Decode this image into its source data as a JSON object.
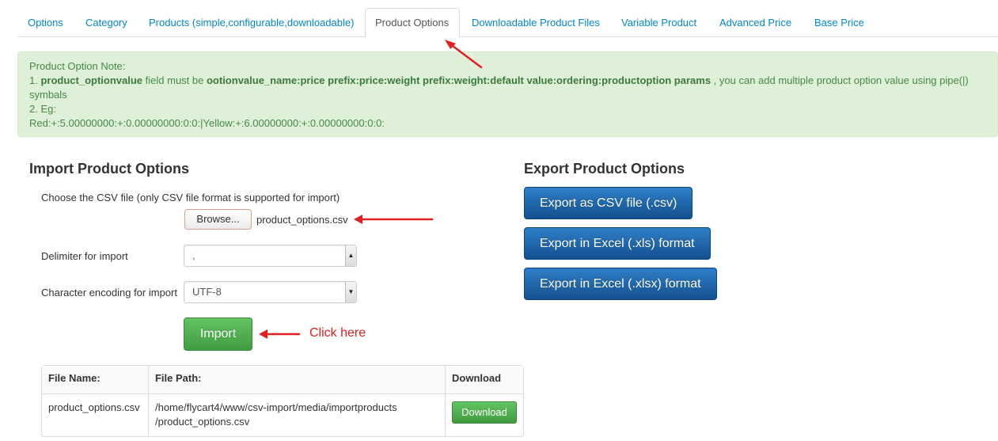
{
  "tabs": [
    {
      "label": "Options"
    },
    {
      "label": "Category"
    },
    {
      "label": "Products (simple,configurable,downloadable)"
    },
    {
      "label": "Product Options",
      "active": true
    },
    {
      "label": "Downloadable Product Files"
    },
    {
      "label": "Variable Product"
    },
    {
      "label": "Advanced Price"
    },
    {
      "label": "Base Price"
    }
  ],
  "note": {
    "title": "Product Option Note:",
    "line1_prefix": "1.",
    "line1_field": "product_optionvalue",
    "line1_mid": "field must be",
    "line1_format": "ootionvalue_name:price prefix:price:weight prefix:weight:default value:ordering:productoption params",
    "line1_suffix": ", you can add multiple product option value using pipe(|)",
    "line1_cont": "symbals",
    "line2": "2. Eg:",
    "example": "Red:+:5.00000000:+:0.00000000:0:0:|Yellow:+:6.00000000:+:0.00000000:0:0:"
  },
  "import": {
    "heading": "Import Product Options",
    "choose_label": "Choose the CSV file (only CSV file format is supported for import)",
    "browse_label": "Browse...",
    "file_name": "product_options.csv",
    "delimiter_label": "Delimiter for import",
    "delimiter_value": ",",
    "encoding_label": "Character encoding for import",
    "encoding_value": "UTF-8",
    "import_button": "Import",
    "annotation": "Click here"
  },
  "table": {
    "headers": [
      "File Name:",
      "File Path:",
      "Download"
    ],
    "rows": [
      {
        "file_name": "product_options.csv",
        "path_line1": "/home/flycart4/www/csv-import/media/importproducts",
        "path_line2": "/product_options.csv",
        "download_label": "Download"
      }
    ]
  },
  "export": {
    "heading": "Export Product Options",
    "buttons": [
      "Export as CSV file (.csv)",
      "Export in Excel (.xls) format",
      "Export in Excel (.xlsx) format"
    ]
  },
  "colors": {
    "link": "#0088cc",
    "note_bg": "#dff0d8",
    "note_text": "#468847",
    "import_green": "#51a351",
    "export_blue": "#1a63ad",
    "annotation_red": "#e02020"
  }
}
